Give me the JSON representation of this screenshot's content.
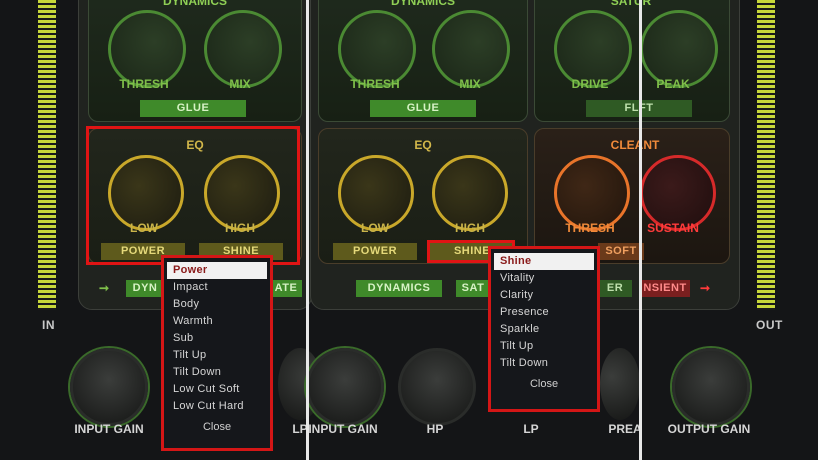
{
  "meters": {
    "in_label": "IN",
    "out_label": "OUT"
  },
  "left_module": {
    "dynamics": {
      "title": "DYNAMICS",
      "thresh": "THRESH",
      "mix": "MIX",
      "button": "GLUE"
    },
    "eq": {
      "title": "EQ",
      "low": "LOW",
      "high": "HIGH",
      "power": "POWER",
      "shine": "SHINE"
    },
    "bottom_chips": {
      "dynamics": "DYN",
      "gate": "ATE"
    }
  },
  "right_module": {
    "dynamics": {
      "title": "DYNAMICS",
      "thresh": "THRESH",
      "mix": "MIX",
      "button": "GLUE"
    },
    "satur": {
      "title": "SATUR",
      "drive": "DRIVE",
      "peak": "PEAK",
      "button": "FLFT"
    },
    "eq": {
      "title": "EQ",
      "low": "LOW",
      "high": "HIGH",
      "power": "POWER",
      "shine": "SHINE"
    },
    "cleant": {
      "title": "CLEANT",
      "thresh": "THRESH",
      "sustain": "SUSTAIN",
      "soft": "SOFT"
    },
    "bottom_chips": {
      "dynamics": "DYNAMICS",
      "sat": "SAT",
      "er": "ER",
      "transient": "NSIENT"
    }
  },
  "bottom": {
    "input_gain": "INPUT GAIN",
    "lp_left": "LP",
    "input_gain_2": "INPUT GAIN",
    "hp": "HP",
    "lp": "LP",
    "pre": "PREA",
    "output_gain": "OUTPUT GAIN"
  },
  "menu_left": {
    "items": [
      "Power",
      "Impact",
      "Body",
      "Warmth",
      "Sub",
      "Tilt Up",
      "Tilt Down",
      "Low Cut Soft",
      "Low Cut Hard"
    ],
    "selected": "Power",
    "close": "Close"
  },
  "menu_right": {
    "items": [
      "Shine",
      "Vitality",
      "Clarity",
      "Presence",
      "Sparkle",
      "Tilt Up",
      "Tilt Down"
    ],
    "selected": "Shine",
    "close": "Close"
  },
  "colors": {
    "accent_green": "#7fbf4a",
    "accent_yellow": "#c9b44a",
    "accent_orange": "#f08a3a",
    "highlight_red": "#e01414"
  }
}
